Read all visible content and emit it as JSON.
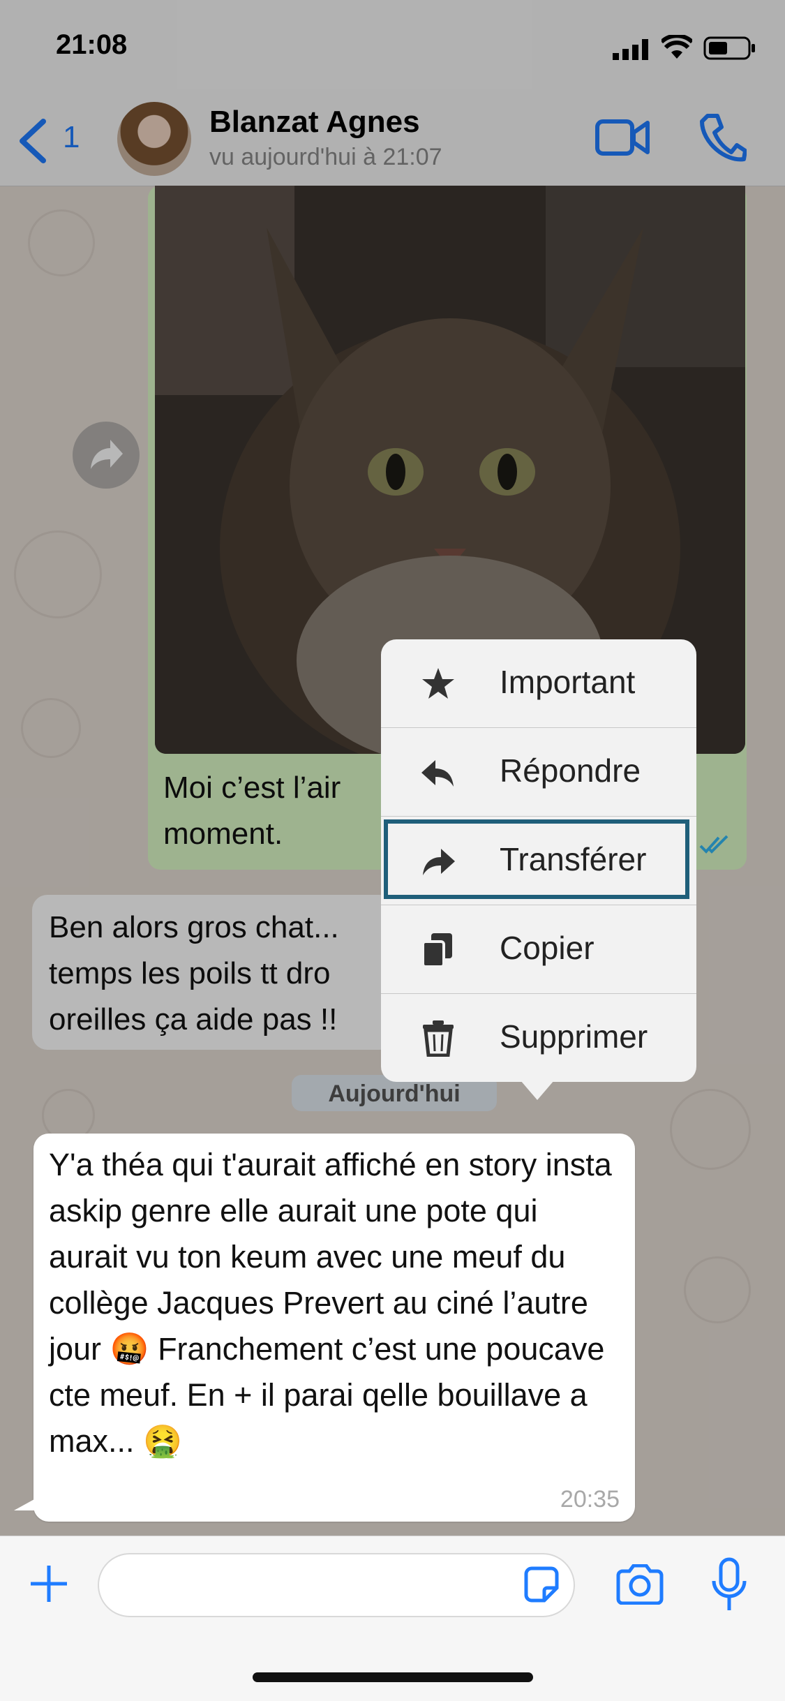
{
  "status_bar": {
    "time": "21:08"
  },
  "header": {
    "back_count": "1",
    "contact_name": "Blanzat Agnes",
    "last_seen": "vu aujourd'hui à 21:07"
  },
  "messages": {
    "photo_caption": "Moi c’est l’air\nmoment.",
    "incoming_1": "Ben alors gros chat...\ntemps les poils tt dro\noreilles ça aide pas !!",
    "date_separator": "Aujourd'hui",
    "incoming_2": "Y'a théa qui t'aurait affiché en story insta askip genre elle aurait une pote qui aurait vu ton keum avec une meuf du collège Jacques Prevert au ciné l’autre jour 🤬 Franchement c’est une poucave cte meuf. En + il parai qelle bouillave a max... 🤮",
    "incoming_2_time": "20:35"
  },
  "context_menu": {
    "items": [
      {
        "label": "Important",
        "icon": "star-icon"
      },
      {
        "label": "Répondre",
        "icon": "reply-icon"
      },
      {
        "label": "Transférer",
        "icon": "forward-icon"
      },
      {
        "label": "Copier",
        "icon": "copy-icon"
      },
      {
        "label": "Supprimer",
        "icon": "trash-icon"
      }
    ]
  },
  "colors": {
    "accent": "#1f7cff",
    "outgoing_bubble": "#dcf8c6",
    "highlight_border": "#1f5f7a"
  }
}
